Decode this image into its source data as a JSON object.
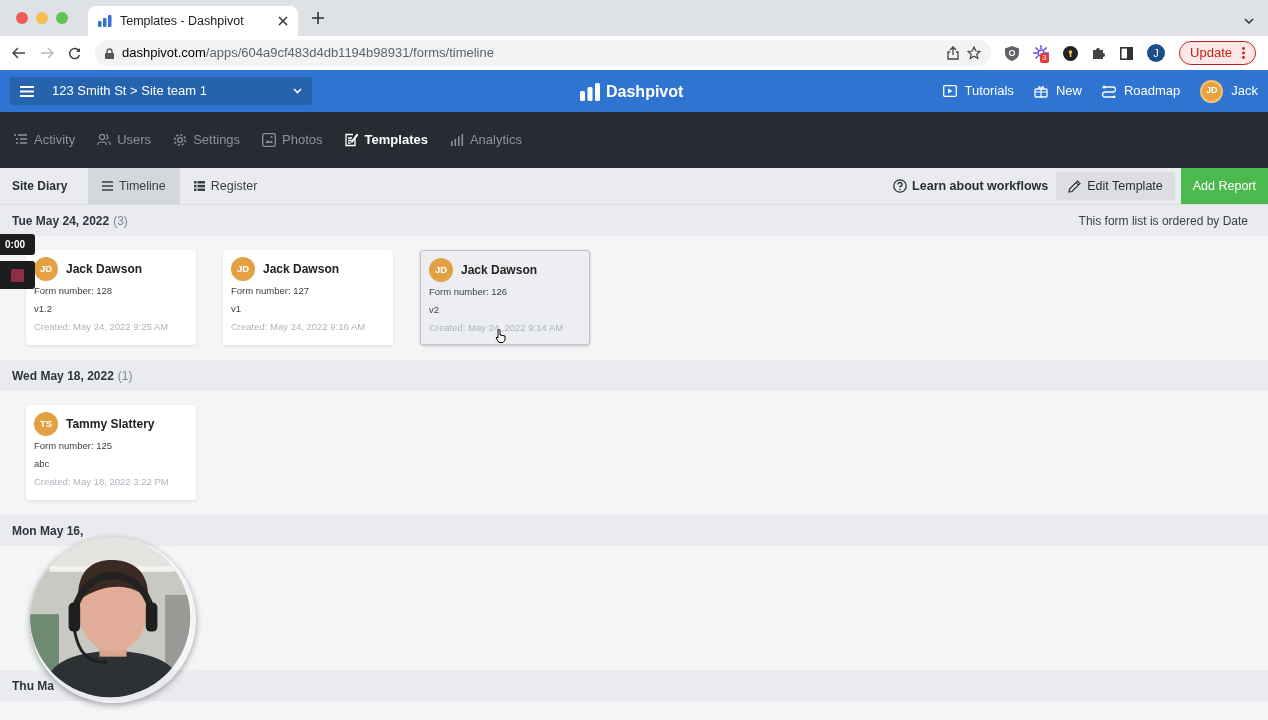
{
  "browser": {
    "tab_title": "Templates - Dashpivot",
    "url_domain": "dashpivot.com",
    "url_path": "/apps/604a9cf483d4db1194b98931/forms/timeline",
    "profile_initial": "J",
    "extension_badge": "3",
    "update_button": "Update"
  },
  "header": {
    "site_selector": "123 Smith St > Site team 1",
    "logo": "Dashpivot",
    "actions": [
      "Tutorials",
      "New",
      "Roadmap"
    ],
    "user": {
      "initials": "JD",
      "name": "Jack"
    }
  },
  "nav": [
    {
      "label": "Activity",
      "selected": false
    },
    {
      "label": "Users",
      "selected": false
    },
    {
      "label": "Settings",
      "selected": false
    },
    {
      "label": "Photos",
      "selected": false
    },
    {
      "label": "Templates",
      "selected": true
    },
    {
      "label": "Analytics",
      "selected": false
    }
  ],
  "subheader": {
    "title": "Site Diary",
    "views": [
      {
        "label": "Timeline",
        "selected": true
      },
      {
        "label": "Register",
        "selected": false
      }
    ],
    "learn_link": "Learn about workflows",
    "edit_button": "Edit Template",
    "add_button": "Add Report"
  },
  "list_note": "This form list is ordered by Date",
  "groups": [
    {
      "date": "Tue May 24, 2022",
      "count": "(3)",
      "forms": [
        {
          "initials": "JD",
          "name": "Jack Dawson",
          "form_number": "Form number: 128",
          "version": "v1.2",
          "created": "Created: May 24, 2022 9:25 AM",
          "highlighted": false
        },
        {
          "initials": "JD",
          "name": "Jack Dawson",
          "form_number": "Form number: 127",
          "version": "v1",
          "created": "Created: May 24, 2022 9:16 AM",
          "highlighted": false
        },
        {
          "initials": "JD",
          "name": "Jack Dawson",
          "form_number": "Form number: 126",
          "version": "v2",
          "created": "Created: May 24, 2022 9:14 AM",
          "highlighted": true
        }
      ]
    },
    {
      "date": "Wed May 18, 2022",
      "count": "(1)",
      "forms": [
        {
          "initials": "TS",
          "name": "Tammy Slattery",
          "form_number": "Form number: 125",
          "version": "abc",
          "created": "Created: May 18, 2022 3:22 PM",
          "highlighted": false
        }
      ]
    },
    {
      "date": "Mon May 16,"
    },
    {
      "date": "Thu Ma"
    }
  ],
  "recorder": {
    "timer": "0:00"
  }
}
